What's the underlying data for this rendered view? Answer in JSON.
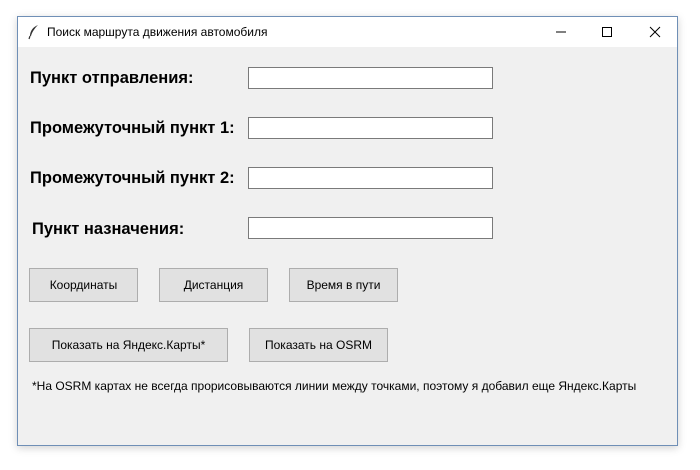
{
  "window": {
    "title": "Поиск маршрута движения автомобиля"
  },
  "form": {
    "departure_label": "Пункт отправления:",
    "departure_value": "",
    "waypoint1_label": "Промежуточный пункт 1:",
    "waypoint1_value": "",
    "waypoint2_label": "Промежуточный пункт 2:",
    "waypoint2_value": "",
    "destination_label": "Пункт назначения:",
    "destination_value": ""
  },
  "buttons": {
    "coordinates": "Координаты",
    "distance": "Дистанция",
    "travel_time": "Время в пути",
    "show_yandex": "Показать на Яндекс.Карты*",
    "show_osrm": "Показать на OSRM"
  },
  "footnote": "*На OSRM картах не всегда прорисовываются линии между точками, поэтому я добавил еще Яндекс.Карты",
  "icons": {
    "app": "feather-icon",
    "minimize": "minimize-icon",
    "maximize": "maximize-icon",
    "close": "close-icon"
  }
}
